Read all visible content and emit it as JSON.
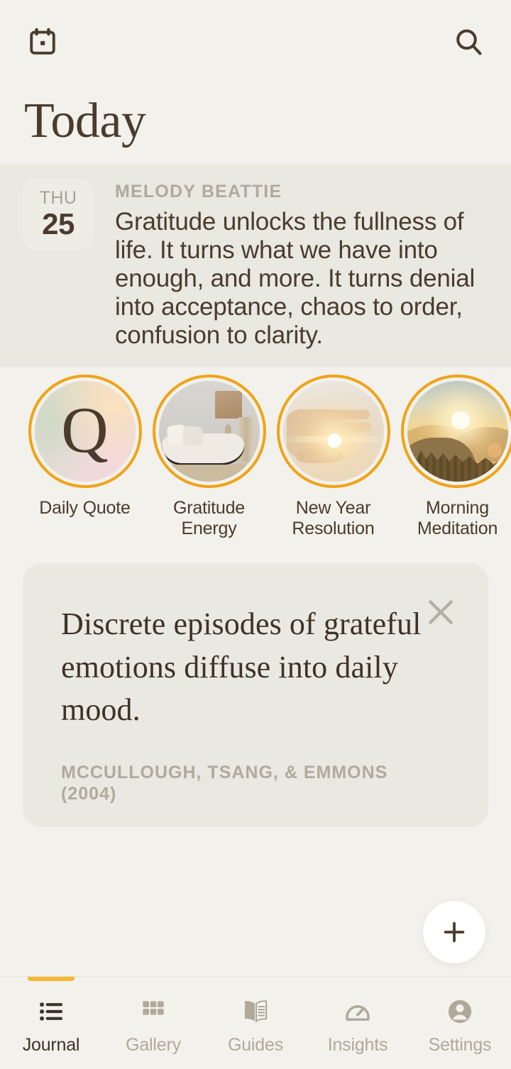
{
  "header": {
    "calendar_icon": "calendar-icon",
    "search_icon": "search-icon",
    "title": "Today"
  },
  "daily_quote": {
    "date_dow": "THU",
    "date_day": "25",
    "author": "MELODY BEATTIE",
    "text": "Gratitude unlocks the fullness of life. It turns what we have into enough, and more. It turns denial into acceptance, chaos to order, confusion to clarity."
  },
  "stories": [
    {
      "label": "Daily Quote",
      "art": "quote-letter-q",
      "letter": "Q"
    },
    {
      "label": "Gratitude Energy",
      "art": "interior-room-photo"
    },
    {
      "label": "New Year Resolution",
      "art": "hand-sunlight-photo"
    },
    {
      "label": "Morning Meditation",
      "art": "mountain-sunrise-photo"
    }
  ],
  "fact_card": {
    "quote": "Discrete episodes of grateful emotions diffuse into daily mood.",
    "source": "MCCULLOUGH, TSANG, & EMMONS (2004)",
    "close_icon": "close-icon"
  },
  "fab": {
    "icon": "plus-icon"
  },
  "tabbar": {
    "items": [
      {
        "label": "Journal",
        "icon": "list-icon",
        "active": true
      },
      {
        "label": "Gallery",
        "icon": "grid-icon",
        "active": false
      },
      {
        "label": "Guides",
        "icon": "book-icon",
        "active": false
      },
      {
        "label": "Insights",
        "icon": "gauge-icon",
        "active": false
      },
      {
        "label": "Settings",
        "icon": "person-icon",
        "active": false
      }
    ]
  },
  "colors": {
    "background": "#f2f1ec",
    "band": "#e9e8e1",
    "accent": "#f0a316",
    "indicator": "#f7b731",
    "text_dark": "#4a3b2c",
    "text_muted": "#b0aa9c"
  }
}
